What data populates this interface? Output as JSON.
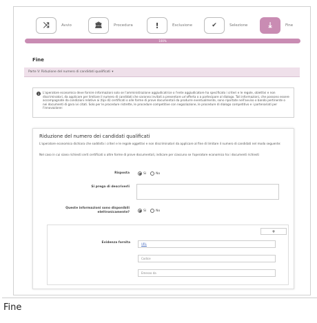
{
  "steps": [
    {
      "label": "Avvio",
      "icon": "shuffle-icon",
      "glyph": "⤨"
    },
    {
      "label": "Procedura",
      "icon": "bank-icon",
      "glyph": "🏛"
    },
    {
      "label": "Esclusione",
      "icon": "exclamation-icon",
      "glyph": "!"
    },
    {
      "label": "Selezione",
      "icon": "check-circle-icon",
      "glyph": "✔"
    },
    {
      "label": "Fine",
      "icon": "download-icon",
      "glyph": "⤓"
    }
  ],
  "progress": {
    "percent_label": "100%",
    "value": 1.0
  },
  "page_title": "Fine",
  "part_bar": {
    "label": "Parte V: Riduzione del numero di candidati qualificati",
    "chevron": "▾"
  },
  "info": {
    "icon": "info-icon",
    "text": "L'operatore economico deve fornire informazioni solo se l'amministrazione aggiudicatrice o l'ente aggiudicatore ha specificato i criteri e le regole, obiettivi e non discriminatori, da applicare per limitare il numero di candidati che saranno invitati a presentare un'offerta o a partecipare al dialogo. Tali informazioni, che possono essere accompagnate da condizioni relative ai (tipi di) certificati o alle forme di prove documentali da produrre eventualmente, sono riportate nell'avviso o bando pertinente o nei documenti di gara ivi citati. Solo per le procedure ristrette, le procedure competitive con negoziazione, le procedure di dialogo competitivo e i partenariati per l'innovazione:"
  },
  "section": {
    "title": "Riduzione del numero dei candidati qualificati",
    "desc1": "L'operatore economico dichiara che soddisfa i criteri e le regole oggettivi e non discriminatori da applicare al fine di limitare il numero di candidati nel modo seguente:",
    "desc2": "Nel caso in cui siano richiesti certi certificati o altre forme di prove documentali, indicare per ciascuno se l'operatore economico ha i documenti richiesti",
    "risposta_label": "Risposta",
    "descrivere_label": "Si prega di descriverli",
    "disponibili_label": "Queste informazioni sono disponibili elettronicamente?",
    "radio_yes": "Sì",
    "radio_no": "No"
  },
  "evidence": {
    "plus_label": "+",
    "label": "Evidenza fornita",
    "url_placeholder": "URL",
    "code_placeholder": "Codice",
    "issuer_placeholder": "Emesso da"
  },
  "caption": "Fine"
}
